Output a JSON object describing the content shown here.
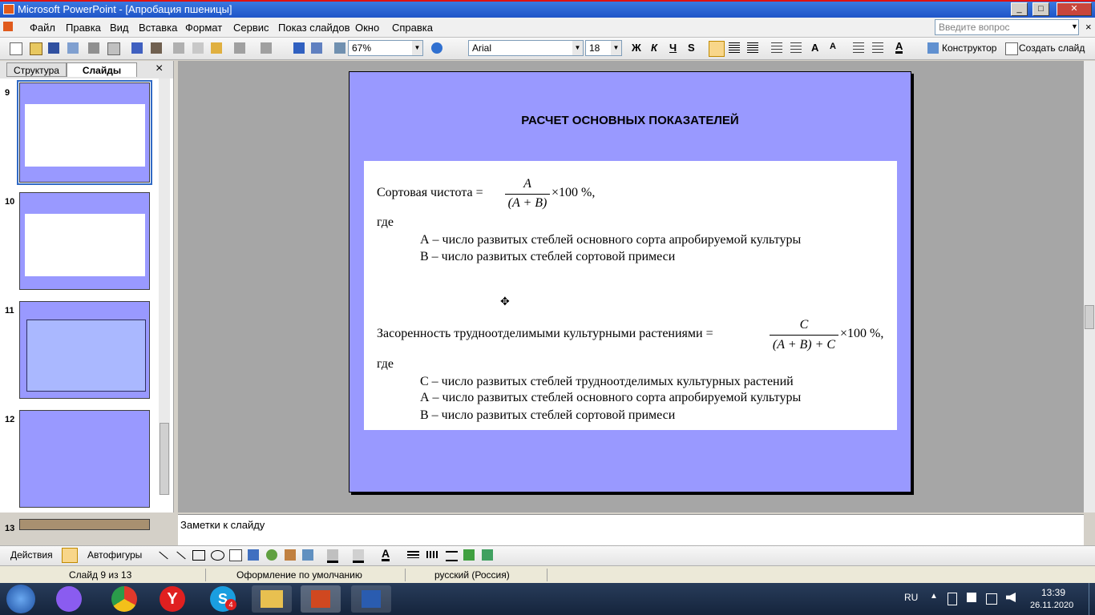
{
  "window": {
    "title": "Microsoft PowerPoint - [Апробация пшеницы]"
  },
  "menu": {
    "items": [
      "Файл",
      "Правка",
      "Вид",
      "Вставка",
      "Формат",
      "Сервис",
      "Показ слайдов",
      "Окно",
      "Справка"
    ],
    "help_placeholder": "Введите вопрос"
  },
  "toolbar": {
    "zoom": "67%",
    "font": "Arial",
    "size": "18",
    "bold": "Ж",
    "italic": "К",
    "underline": "Ч",
    "shadow": "S",
    "designer": "Конструктор",
    "new_slide": "Создать слайд"
  },
  "left_pane": {
    "tabs": [
      "Структура",
      "Слайды"
    ],
    "close": "×",
    "slide_numbers": [
      "9",
      "10",
      "11",
      "12",
      "13"
    ]
  },
  "slide": {
    "title": "РАСЧЕТ ОСНОВНЫХ ПОКАЗАТЕЛЕЙ",
    "formula1": {
      "label": "Сортовая чистота =",
      "numerator": "A",
      "denominator": "(A + B)",
      "tail": "×100 %,"
    },
    "where1": "где",
    "def_a1": "А – число развитых стеблей основного сорта апробируемой культуры",
    "def_b1": "В – число развитых стеблей сортовой примеси",
    "formula2": {
      "label": "Засоренность трудноотделимыми культурными растениями =",
      "numerator": "C",
      "denominator": "(A + B) + C",
      "tail": "×100 %,"
    },
    "where2": "где",
    "def_c2": "С – число развитых стеблей трудноотделимых культурных растений",
    "def_a2": "А – число развитых стеблей основного сорта апробируемой культуры",
    "def_b2": "В – число развитых стеблей сортовой примеси"
  },
  "notes": {
    "placeholder": "Заметки к слайду"
  },
  "draw_toolbar": {
    "actions": "Действия",
    "autoshapes": "Автофигуры"
  },
  "status": {
    "slide": "Слайд 9 из 13",
    "design": "Оформление по умолчанию",
    "language": "русский (Россия)"
  },
  "taskbar": {
    "lang": "RU",
    "time": "13:39",
    "date": "26.11.2020",
    "skype_badge": "4"
  },
  "colors": {
    "slide_bg": "#9999ff",
    "titlebar": "#2a63d4",
    "canvas": "#a6a6a6"
  }
}
